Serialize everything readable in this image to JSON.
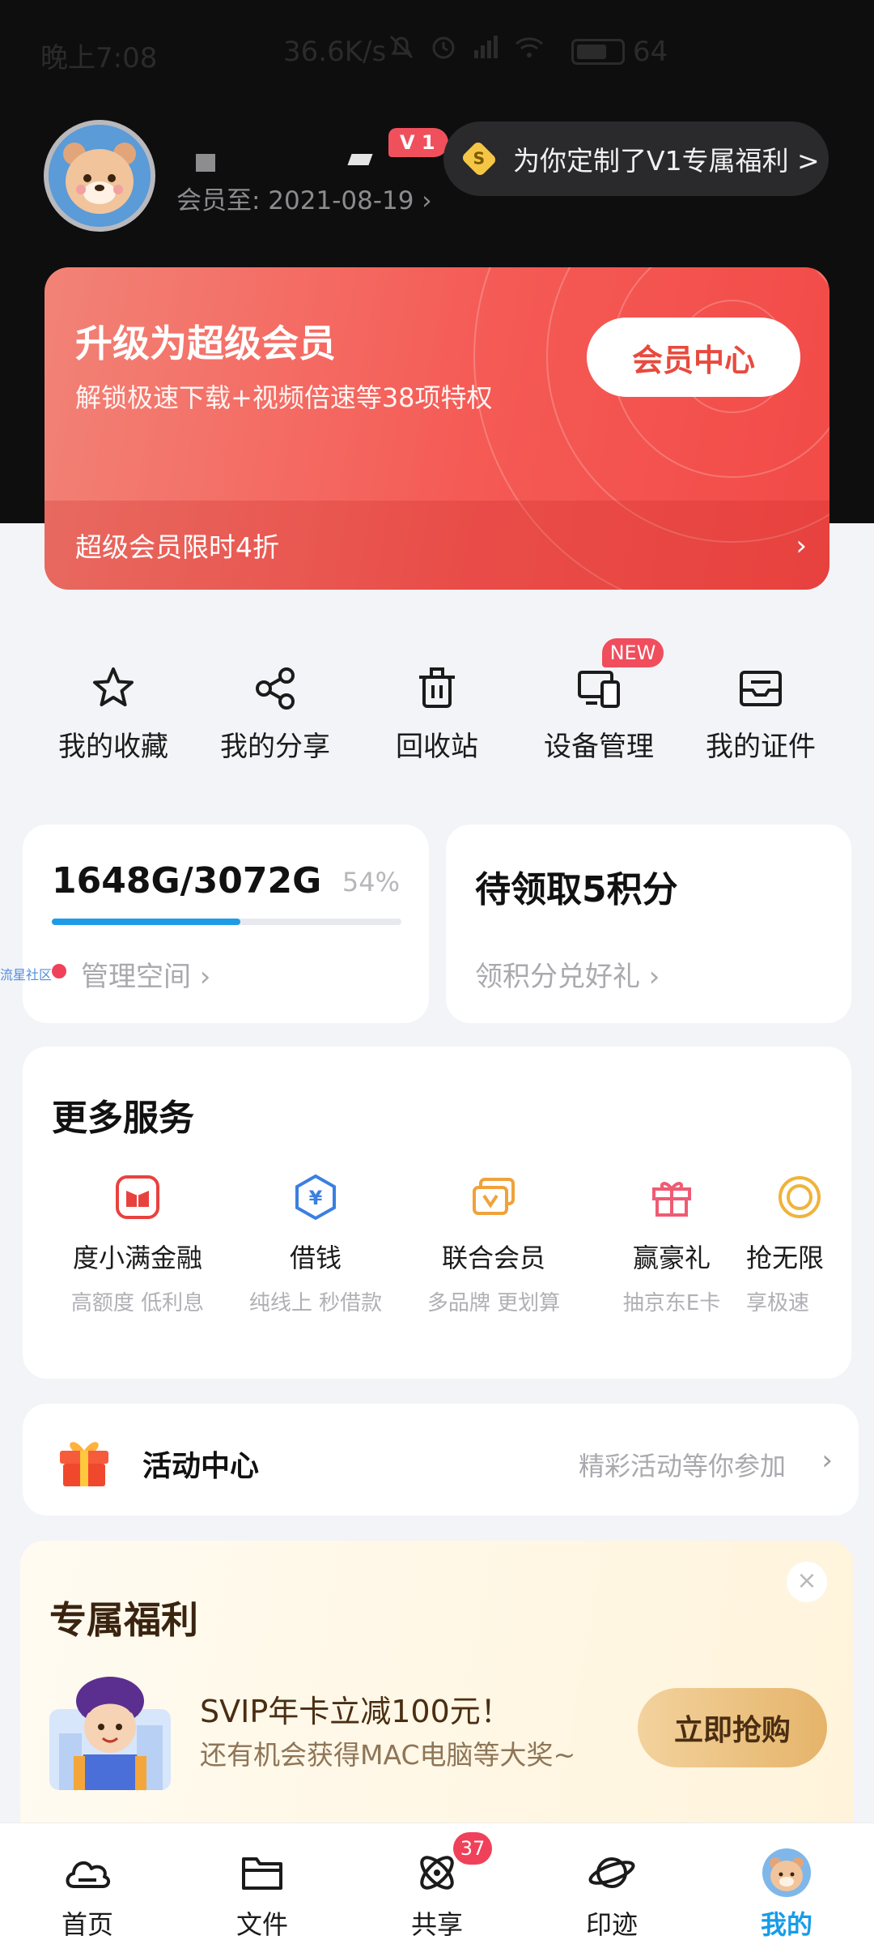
{
  "status_bar": {
    "time": "晚上7:08",
    "speed": "36.6K/s",
    "battery": "64"
  },
  "profile": {
    "member_until": "会员至: 2021-08-19 ›",
    "vip_badge": "V 1",
    "promo_text": "为你定制了V1专属福利 >",
    "promo_coin": "S"
  },
  "vip_banner": {
    "title": "升级为超级会员",
    "subtitle": "解锁极速下载+视频倍速等38项特权",
    "center_button": "会员中心",
    "bottom_text": "超级会员限时4折",
    "chevron": "›"
  },
  "quick_actions": [
    {
      "label": "我的收藏",
      "icon": "star-icon"
    },
    {
      "label": "我的分享",
      "icon": "share-nodes-icon"
    },
    {
      "label": "回收站",
      "icon": "trash-icon"
    },
    {
      "label": "设备管理",
      "icon": "devices-icon"
    },
    {
      "label": "我的证件",
      "icon": "id-card-icon"
    }
  ],
  "new_badge": "NEW",
  "storage": {
    "used_total": "1648G/3072G",
    "percent_label": "54%",
    "percent": 54,
    "manage_link": "管理空间 ›",
    "watermark": "流星社区"
  },
  "points": {
    "title": "待领取5积分",
    "link": "领积分兑好礼 ›"
  },
  "more_services": {
    "title": "更多服务",
    "items": [
      {
        "name": "度小满金融",
        "desc": "高额度 低利息",
        "icon": "wallet-red-icon",
        "color": "#e8423f"
      },
      {
        "name": "借钱",
        "desc": "纯线上  秒借款",
        "icon": "yen-hexagon-icon",
        "color": "#3b7fe0"
      },
      {
        "name": "联合会员",
        "desc": "多品牌 更划算",
        "icon": "membership-cards-icon",
        "color": "#f0a23a"
      },
      {
        "name": "赢豪礼",
        "desc": "抽京东E卡",
        "icon": "gift-icon",
        "color": "#ef5b73"
      },
      {
        "name": "抢无限",
        "desc": "享极速",
        "icon": "speed-icon",
        "color": "#f0b33a"
      }
    ]
  },
  "activity": {
    "label": "活动中心",
    "desc": "精彩活动等你参加",
    "chevron": "›"
  },
  "benefit": {
    "title": "专属福利",
    "line1": "SVIP年卡立减100元！",
    "line2": "还有机会获得MAC电脑等大奖~",
    "button": "立即抢购",
    "close": "×"
  },
  "bottom_nav": [
    {
      "label": "首页",
      "icon": "home-cloud-icon"
    },
    {
      "label": "文件",
      "icon": "folder-icon"
    },
    {
      "label": "共享",
      "icon": "atom-share-icon"
    },
    {
      "label": "印迹",
      "icon": "planet-icon"
    },
    {
      "label": "我的",
      "icon": "bear-avatar-icon"
    }
  ],
  "share_badge": "37",
  "colors": {
    "accent": "#169ce8",
    "vip_red": "#f24a47",
    "badge_red": "#f0415a"
  }
}
